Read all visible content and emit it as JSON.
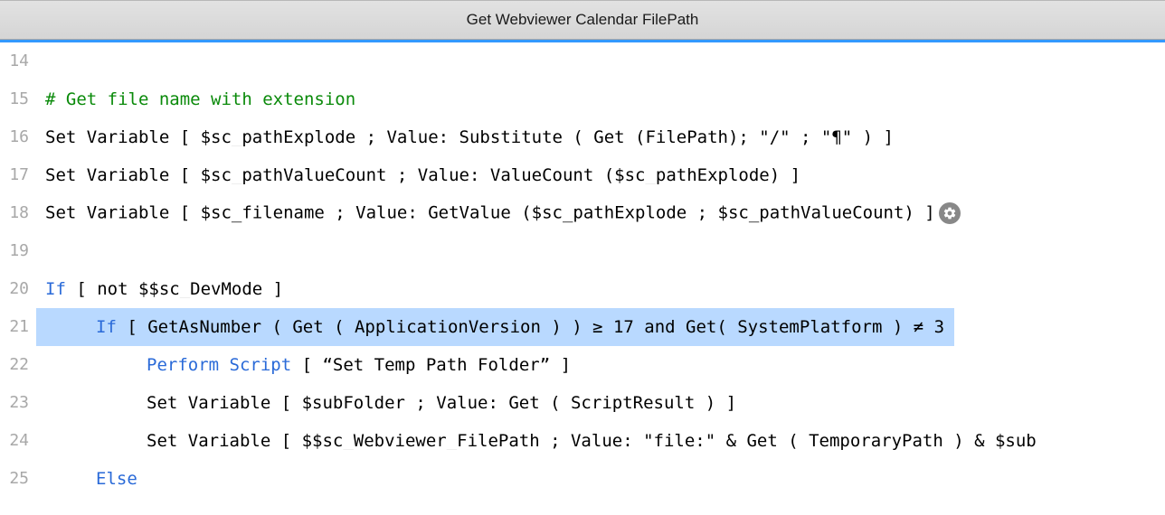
{
  "title": "Get Webviewer Calendar FilePath",
  "lines": [
    {
      "num": 14,
      "indent": 0,
      "segments": []
    },
    {
      "num": 15,
      "indent": 0,
      "segments": [
        {
          "cls": "comment",
          "text": "# Get file name with extension"
        }
      ]
    },
    {
      "num": 16,
      "indent": 0,
      "segments": [
        {
          "cls": "",
          "text": "Set Variable [ $sc_pathExplode ; Value: Substitute ( Get (FilePath); \"/\" ; \"¶\" ) ]"
        }
      ]
    },
    {
      "num": 17,
      "indent": 0,
      "segments": [
        {
          "cls": "",
          "text": "Set Variable [ $sc_pathValueCount ; Value: ValueCount ($sc_pathExplode) ]"
        }
      ]
    },
    {
      "num": 18,
      "indent": 0,
      "segments": [
        {
          "cls": "",
          "text": "Set Variable [ $sc_filename ; Value: GetValue ($sc_pathExplode ; $sc_pathValueCount) ]"
        }
      ],
      "gear": true
    },
    {
      "num": 19,
      "indent": 0,
      "segments": []
    },
    {
      "num": 20,
      "indent": 0,
      "segments": [
        {
          "cls": "keyword",
          "text": "If"
        },
        {
          "cls": "",
          "text": " [ not $$sc_DevMode ]"
        }
      ]
    },
    {
      "num": 21,
      "indent": 1,
      "highlighted": true,
      "segments": [
        {
          "cls": "keyword",
          "text": "If"
        },
        {
          "cls": "",
          "text": " [ "
        },
        {
          "cls": "highlight-seg",
          "text": "GetAsNumber ( Get ( ApplicationVersion ) ) ≥ 17 and Get( SystemPlatform ) ≠ 3 "
        }
      ]
    },
    {
      "num": 22,
      "indent": 2,
      "segments": [
        {
          "cls": "keyword",
          "text": "Perform Script"
        },
        {
          "cls": "",
          "text": " [ “Set Temp Path Folder” ]"
        }
      ]
    },
    {
      "num": 23,
      "indent": 2,
      "segments": [
        {
          "cls": "",
          "text": "Set Variable [ $subFolder ; Value: Get ( ScriptResult ) ]"
        }
      ]
    },
    {
      "num": 24,
      "indent": 2,
      "segments": [
        {
          "cls": "",
          "text": "Set Variable [ $$sc_Webviewer_FilePath ; Value: \"file:\" & Get ( TemporaryPath ) & $sub"
        }
      ]
    },
    {
      "num": 25,
      "indent": 1,
      "segments": [
        {
          "cls": "keyword",
          "text": "Else"
        }
      ]
    }
  ]
}
